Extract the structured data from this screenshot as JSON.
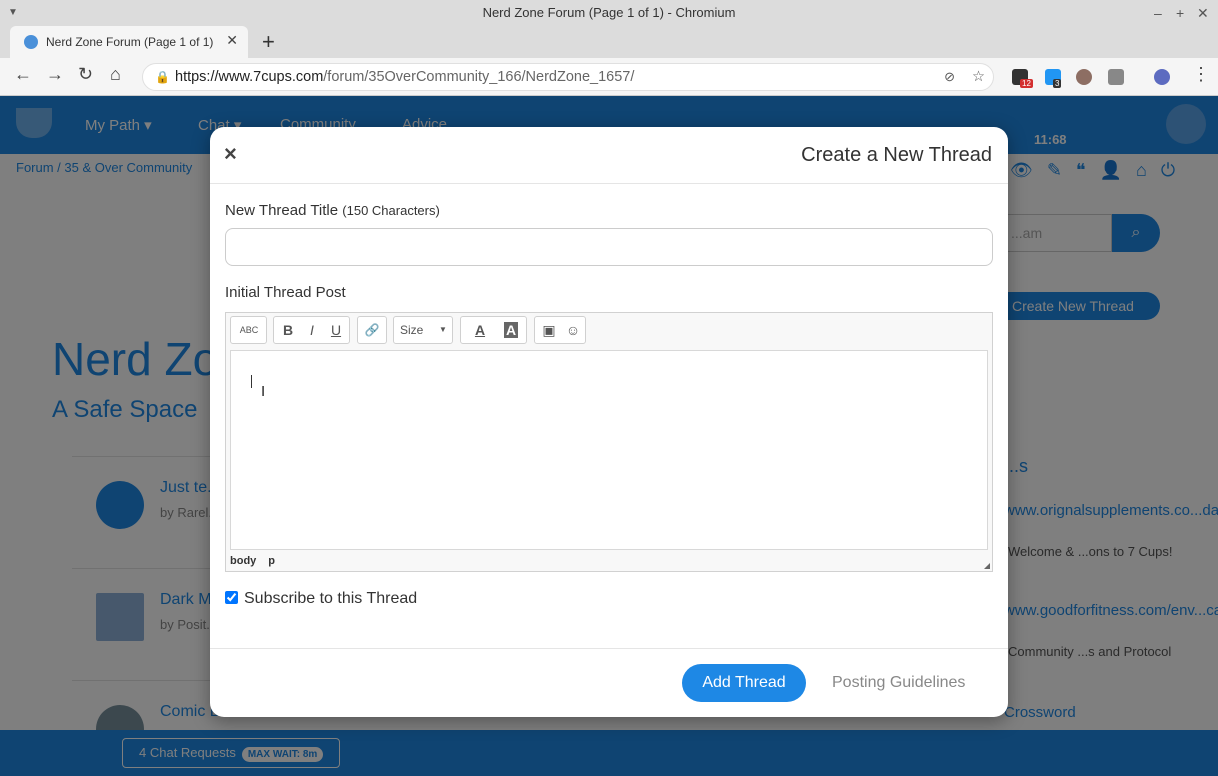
{
  "browser": {
    "window_title": "Nerd Zone Forum (Page 1 of 1) - Chromium",
    "tab_title": "Nerd Zone Forum (Page 1 of 1)",
    "url_host": "https://www.7cups.com",
    "url_path": "/forum/35OverCommunity_166/NerdZone_1657/",
    "ext_badges": [
      "12",
      "3"
    ]
  },
  "site": {
    "nav_links": [
      "My Path ▾",
      "Chat ▾",
      "Community",
      "Advice"
    ],
    "clock": "11:68",
    "breadcrumb": "Forum  /  35 & Over Community",
    "search_placeholder": "...am",
    "create_button": "Create New Thread",
    "page_title": "Nerd Zone",
    "page_subtitle": "A Safe Space",
    "threads": [
      {
        "title": "Just te...",
        "by": "by  Rarel..."
      },
      {
        "title": "Dark M...",
        "by": "by  Posit..."
      },
      {
        "title": "Comic Book Nerds ASSEMBLE!!!",
        "by": ""
      }
    ],
    "sidebar": {
      "heading": "...s",
      "links": [
        {
          "link": "www.orignalsupplements.co...da/",
          "sub": "Welcome & ...ons to 7 Cups!"
        },
        {
          "link": "www.goodforfitness.com/env...canada/",
          "sub": "Community ...s and Protocol"
        },
        {
          "link": "Crossword",
          "sub": ""
        }
      ]
    },
    "chat_requests": "4 Chat Requests",
    "max_wait": "MAX WAIT: 8m"
  },
  "modal": {
    "title": "Create a New Thread",
    "close": "×",
    "thread_title_label": "New Thread Title",
    "thread_title_hint": "(150 Characters)",
    "thread_title_value": "",
    "post_label": "Initial Thread Post",
    "toolbar": {
      "spellcheck": "ABC",
      "bold": "B",
      "italic": "I",
      "underline": "U",
      "link": "🔗",
      "size": "Size",
      "font_color": "A",
      "bg_color": "A",
      "image": "▣",
      "emoji": "☺"
    },
    "path": [
      "body",
      "p"
    ],
    "subscribe_label": "Subscribe to this Thread",
    "subscribe_checked": true,
    "add_button": "Add Thread",
    "guidelines": "Posting Guidelines"
  }
}
